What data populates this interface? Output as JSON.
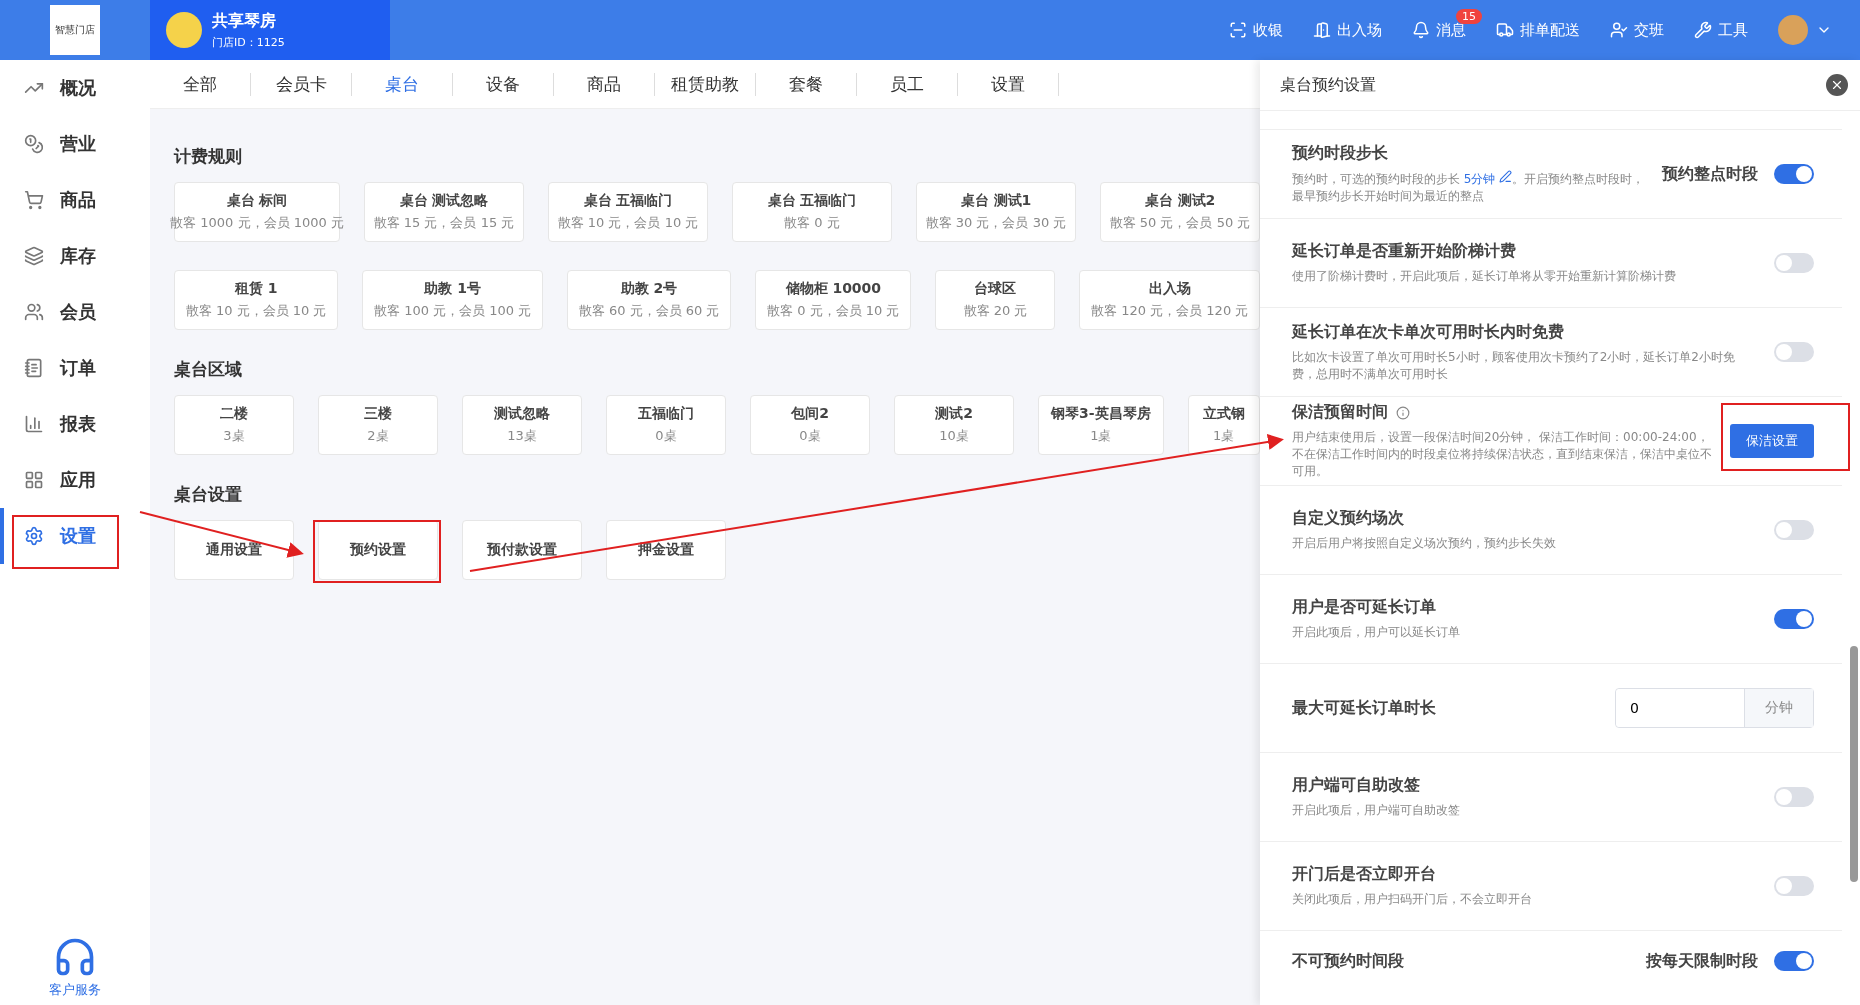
{
  "brand": {
    "logo_text": "智慧门店",
    "shop_name": "共享琴房",
    "shop_id": "门店ID：1125"
  },
  "header_actions": [
    {
      "kind": "cashier",
      "label": "收银"
    },
    {
      "kind": "door",
      "label": "出入场"
    },
    {
      "kind": "bell",
      "label": "消息",
      "badge": "15"
    },
    {
      "kind": "delivery",
      "label": "排单配送"
    },
    {
      "kind": "shift",
      "label": "交班"
    },
    {
      "kind": "tools",
      "label": "工具"
    }
  ],
  "sidebar": {
    "items": [
      {
        "kind": "chart",
        "label": "概况",
        "selected": false
      },
      {
        "kind": "money",
        "label": "营业",
        "selected": false
      },
      {
        "kind": "cart",
        "label": "商品",
        "selected": false
      },
      {
        "kind": "layers",
        "label": "库存",
        "selected": false
      },
      {
        "kind": "users",
        "label": "会员",
        "selected": false
      },
      {
        "kind": "order",
        "label": "订单",
        "selected": false
      },
      {
        "kind": "report",
        "label": "报表",
        "selected": false
      },
      {
        "kind": "apps",
        "label": "应用",
        "selected": false
      },
      {
        "kind": "settings",
        "label": "设置",
        "selected": true
      }
    ],
    "support": "客户服务"
  },
  "tabs": [
    {
      "label": "全部",
      "selected": false
    },
    {
      "label": "会员卡",
      "selected": false
    },
    {
      "label": "桌台",
      "selected": true
    },
    {
      "label": "设备",
      "selected": false
    },
    {
      "label": "商品",
      "selected": false
    },
    {
      "label": "租赁助教",
      "selected": false
    },
    {
      "label": "套餐",
      "selected": false
    },
    {
      "label": "员工",
      "selected": false
    },
    {
      "label": "设置",
      "selected": false
    }
  ],
  "billing_rules": {
    "title": "计费规则",
    "rows": [
      [
        {
          "name": "桌台 标间",
          "price": "散客 1000 元，会员 1000 元"
        },
        {
          "name": "桌台 测试忽略",
          "price": "散客 15 元，会员 15 元"
        },
        {
          "name": "桌台 五福临门",
          "price": "散客 10 元，会员 10 元"
        },
        {
          "name": "桌台 五福临门",
          "price": "散客 0 元"
        },
        {
          "name": "桌台 测试1",
          "price": "散客 30 元，会员 30 元"
        },
        {
          "name": "桌台 测试2",
          "price": "散客 50 元，会员 50 元"
        }
      ],
      [
        {
          "name": "租赁 1",
          "price": "散客 10 元，会员 10 元"
        },
        {
          "name": "助教 1号",
          "price": "散客 100 元，会员 100 元"
        },
        {
          "name": "助教 2号",
          "price": "散客 60 元，会员 60 元"
        },
        {
          "name": "储物柜 10000",
          "price": "散客 0 元，会员 10 元"
        },
        {
          "name": "台球区",
          "price": "散客 20 元"
        },
        {
          "name": "出入场",
          "price": "散客 120 元，会员 120 元"
        }
      ]
    ]
  },
  "areas": {
    "title": "桌台区域",
    "items": [
      {
        "name": "二楼",
        "count": "3桌"
      },
      {
        "name": "三楼",
        "count": "2桌"
      },
      {
        "name": "测试忽略",
        "count": "13桌"
      },
      {
        "name": "五福临门",
        "count": "0桌"
      },
      {
        "name": "包间2",
        "count": "0桌"
      },
      {
        "name": "测试2",
        "count": "10桌"
      },
      {
        "name": "钢琴3-英昌琴房",
        "count": "1桌"
      },
      {
        "name": "立式钢",
        "count": "1桌"
      }
    ]
  },
  "table_settings": {
    "title": "桌台设置",
    "items": [
      {
        "label": "通用设置"
      },
      {
        "label": "预约设置"
      },
      {
        "label": "预付款设置"
      },
      {
        "label": "押金设置"
      }
    ]
  },
  "panel": {
    "title": "桌台预约设置",
    "rows": [
      {
        "kind": "toggle",
        "title": "预约时段步长",
        "side_label": "预约整点时段",
        "on": true,
        "desc_before": "预约时，可选的预约时段的步长 ",
        "desc_link": "5分钟",
        "desc_after": "。开启预约整点时段时，最早预约步长开始时间为最近的整点"
      },
      {
        "kind": "toggle",
        "title": "延长订单是否重新开始阶梯计费",
        "on": false,
        "desc_before": "使用了阶梯计费时，开启此项后，延长订单将从零开始重新计算阶梯计费"
      },
      {
        "kind": "toggle",
        "title": "延长订单在次卡单次可用时长内时免费",
        "on": false,
        "desc_before": "比如次卡设置了单次可用时长5小时，顾客使用次卡预约了2小时，延长订单2小时免费，总用时不满单次可用时长"
      },
      {
        "kind": "button",
        "title": "保洁预留时间",
        "button": "保洁设置",
        "desc_before": "用户结束使用后，设置一段保洁时间20分钟， 保洁工作时间：00:00-24:00，不在保洁工作时间内的时段桌位将持续保洁状态，直到结束保洁，保洁中桌位不可用。"
      },
      {
        "kind": "toggle",
        "title": "自定义预约场次",
        "on": false,
        "desc_before": "开启后用户将按照自定义场次预约，预约步长失效"
      },
      {
        "kind": "toggle",
        "title": "用户是否可延长订单",
        "on": true,
        "desc_before": "开启此项后，用户可以延长订单"
      },
      {
        "kind": "input",
        "title": "最大可延长订单时长",
        "value": "0",
        "unit": "分钟"
      },
      {
        "kind": "toggle",
        "title": "用户端可自助改签",
        "on": false,
        "desc_before": "开启此项后，用户端可自助改签"
      },
      {
        "kind": "toggle",
        "title": "开门后是否立即开台",
        "on": false,
        "desc_before": "关闭此项后，用户扫码开门后，不会立即开台"
      },
      {
        "kind": "toggle",
        "title": "不可预约时间段",
        "side_label": "按每天限制时段",
        "on": true
      }
    ]
  }
}
